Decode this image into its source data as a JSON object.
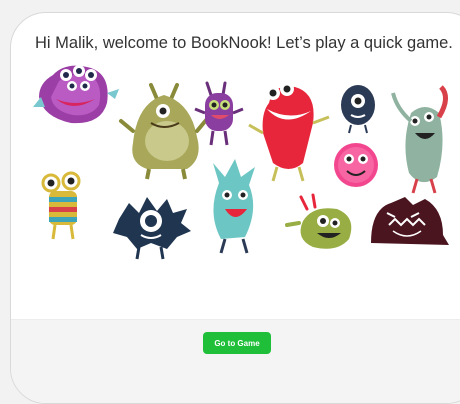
{
  "greeting": "Hi Malik, welcome to BookNook! Let’s play a quick game.",
  "button_label": "Go to Game",
  "colors": {
    "button": "#1fbf3a",
    "card_bg": "#ffffff",
    "footer_bg": "#f4f4f4"
  },
  "illustration": [
    "purple-monster-icon",
    "olive-monster-icon",
    "violet-monster-icon",
    "red-monster-icon",
    "navy-monster-icon",
    "green-monster-icon",
    "striped-monster-icon",
    "navy-spiky-monster-icon",
    "teal-monster-icon",
    "pink-fuzzy-monster-icon",
    "lime-monster-icon",
    "maroon-monster-icon"
  ]
}
